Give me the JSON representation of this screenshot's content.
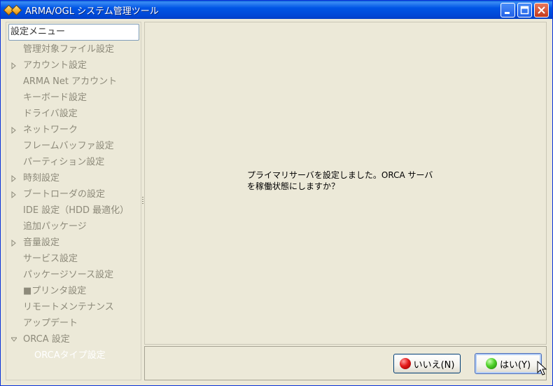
{
  "window": {
    "title": "ARMA/OGL システム管理ツール"
  },
  "sidebar": {
    "header": "設定メニュー",
    "items": [
      {
        "label": "管理対象ファイル設定",
        "expander": "none"
      },
      {
        "label": "アカウント設定",
        "expander": "collapsed"
      },
      {
        "label": "ARMA Net アカウント",
        "expander": "none"
      },
      {
        "label": "キーボード設定",
        "expander": "none"
      },
      {
        "label": "ドライバ設定",
        "expander": "none"
      },
      {
        "label": "ネットワーク",
        "expander": "collapsed"
      },
      {
        "label": "フレームバッファ設定",
        "expander": "none"
      },
      {
        "label": "パーティション設定",
        "expander": "none"
      },
      {
        "label": "時刻設定",
        "expander": "collapsed"
      },
      {
        "label": "ブートローダの設定",
        "expander": "collapsed"
      },
      {
        "label": "IDE 設定（HDD 最適化）",
        "expander": "none"
      },
      {
        "label": "追加パッケージ",
        "expander": "none"
      },
      {
        "label": "音量設定",
        "expander": "collapsed"
      },
      {
        "label": "サービス設定",
        "expander": "none"
      },
      {
        "label": "パッケージソース設定",
        "expander": "none"
      },
      {
        "label": "■プリンタ設定",
        "expander": "none"
      },
      {
        "label": "リモートメンテナンス",
        "expander": "none"
      },
      {
        "label": "アップデート",
        "expander": "none"
      },
      {
        "label": "ORCA 設定",
        "expander": "expanded"
      },
      {
        "label": "ORCAタイプ設定",
        "expander": "child"
      }
    ]
  },
  "dialog": {
    "message_line1": "プライマリサーバを設定しました。ORCA サーバ",
    "message_line2": "を稼働状態にしますか？"
  },
  "buttons": {
    "no_label": "いいえ(N)",
    "yes_label": "はい(Y)"
  },
  "colors": {
    "titlebar": "#0055e5",
    "menu_text": "#8d8a7a",
    "no_icon": "#e41a1a",
    "yes_icon": "#4fd12a"
  }
}
